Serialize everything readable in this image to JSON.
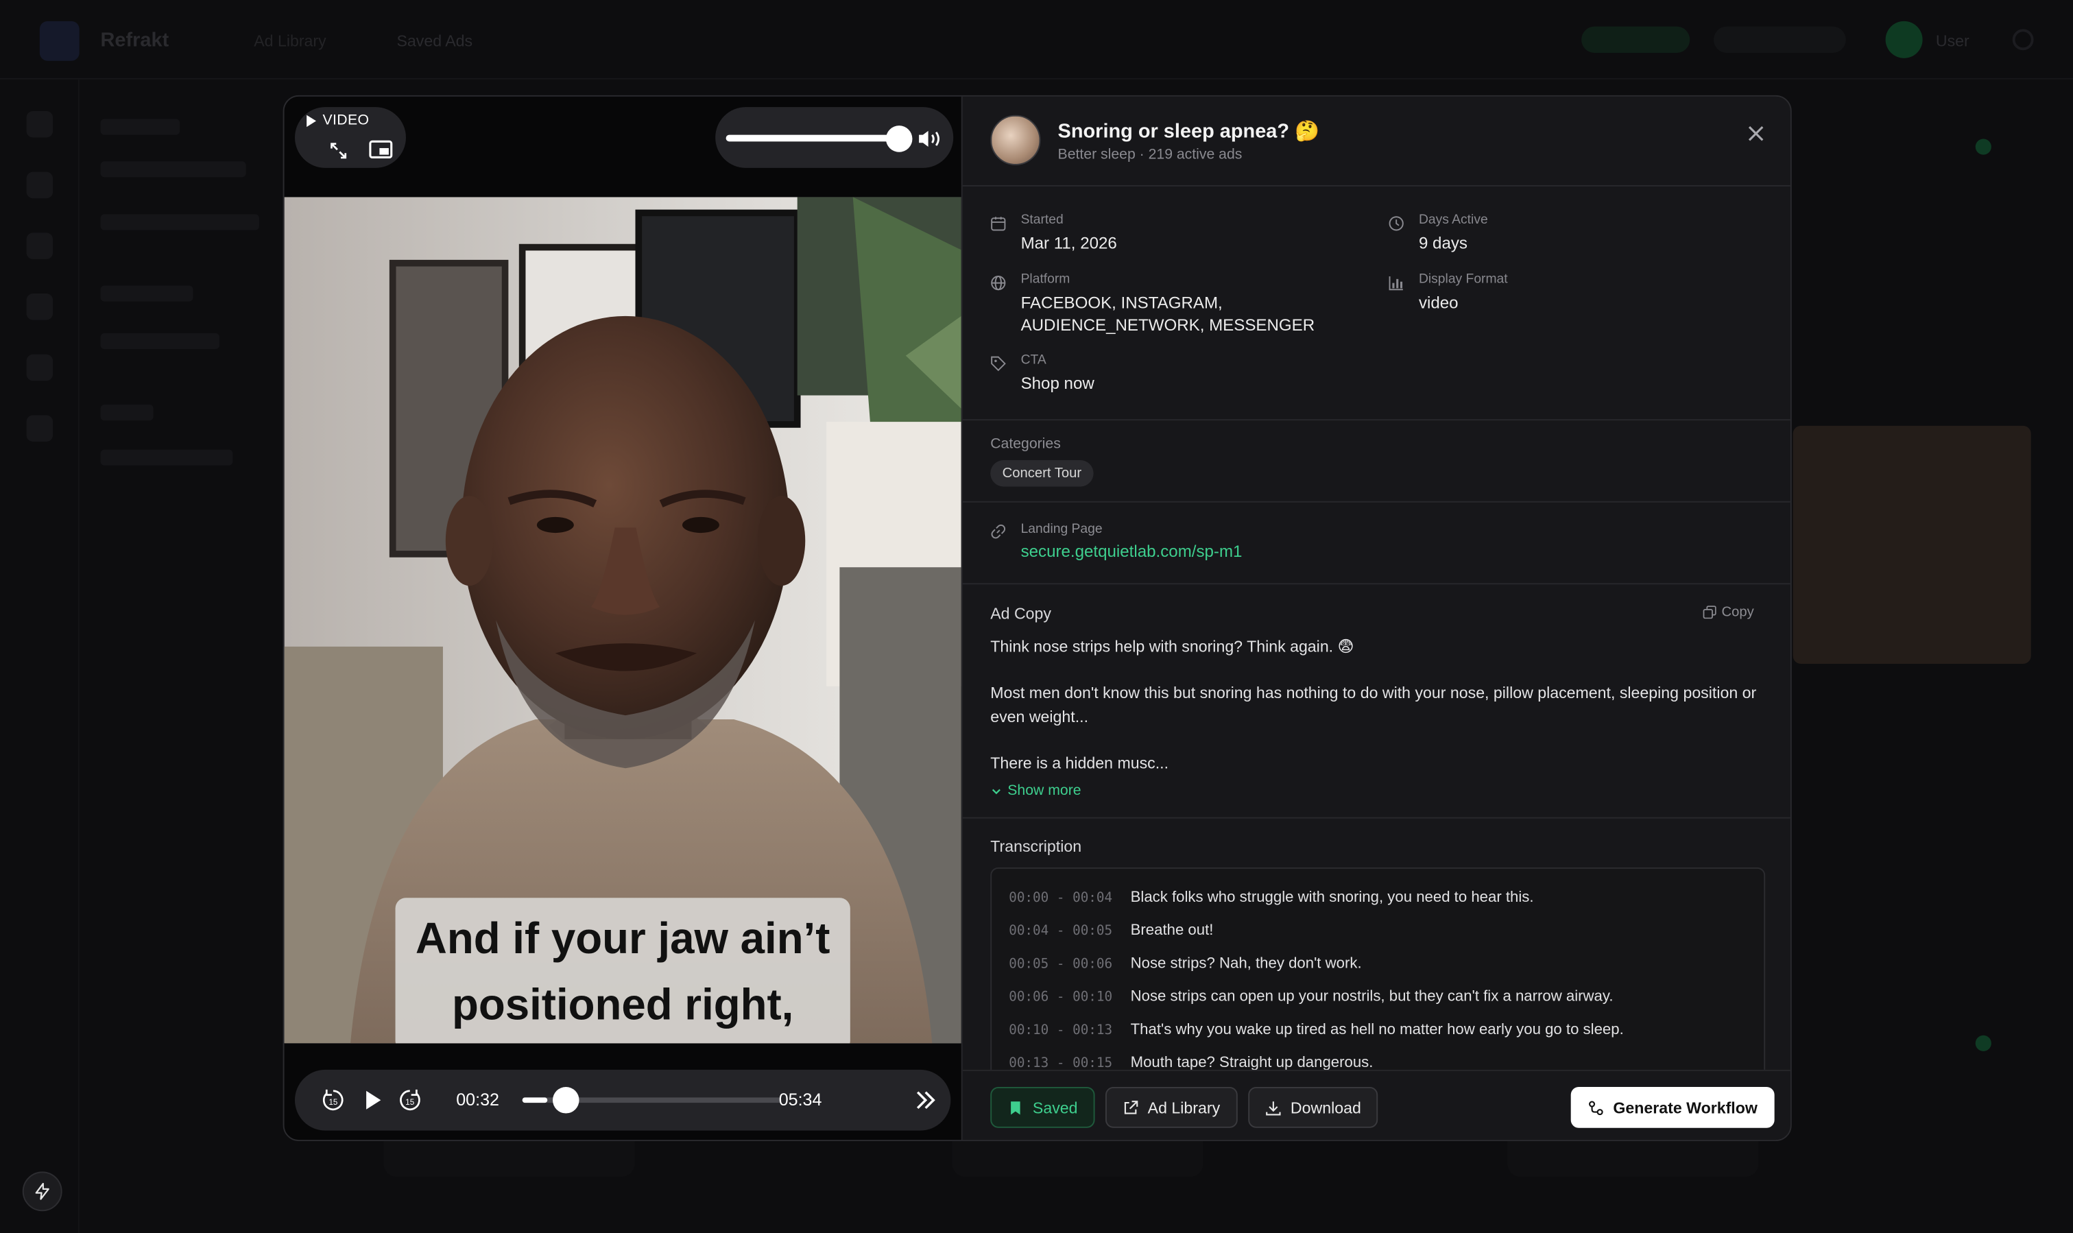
{
  "backdrop": {
    "brand": "Refrakt",
    "nav_1": "Ad Library",
    "nav_2": "Saved Ads",
    "user_label": "User"
  },
  "player": {
    "badge": "VIDEO",
    "caption_line1": "And if your jaw ain’t",
    "caption_line2": "positioned right,",
    "current_time": "00:32",
    "duration": "05:34",
    "progress_fraction": 0.096,
    "volume_fraction": 0.88,
    "skip_back_seconds": "15",
    "skip_forward_seconds": "15"
  },
  "ad": {
    "title": "Snoring or sleep apnea? 🤔",
    "subtitle": "Better sleep · 219 active ads"
  },
  "meta": {
    "started_label": "Started",
    "started_value": "Mar 11, 2026",
    "days_label": "Days Active",
    "days_value": "9 days",
    "platform_label": "Platform",
    "platform_value_line1": "FACEBOOK, INSTAGRAM,",
    "platform_value_line2": "AUDIENCE_NETWORK, MESSENGER",
    "format_label": "Display Format",
    "format_value": "video",
    "cta_label": "CTA",
    "cta_value": "Shop now"
  },
  "categories": {
    "label": "Categories",
    "items": [
      "Concert Tour"
    ]
  },
  "landing": {
    "label": "Landing Page",
    "url": "secure.getquietlab.com/sp-m1"
  },
  "ad_copy": {
    "title": "Ad Copy",
    "copy_label": "Copy",
    "para1": "Think nose strips help with snoring? Think again. 😨",
    "para2": "Most men don't know this but snoring has nothing to do with your nose, pillow placement, sleeping position or even weight...",
    "para3": "There is a hidden musc...",
    "show_more": "Show more"
  },
  "transcription": {
    "title": "Transcription",
    "rows": [
      {
        "time": "00:00 - 00:04",
        "text": "Black folks who struggle with snoring, you need to hear this."
      },
      {
        "time": "00:04 - 00:05",
        "text": "Breathe out!"
      },
      {
        "time": "00:05 - 00:06",
        "text": "Nose strips? Nah, they don't work."
      },
      {
        "time": "00:06 - 00:10",
        "text": "Nose strips can open up your nostrils, but they can't fix a narrow airway."
      },
      {
        "time": "00:10 - 00:13",
        "text": "That's why you wake up tired as hell no matter how early you go to sleep."
      },
      {
        "time": "00:13 - 00:15",
        "text": "Mouth tape? Straight up dangerous."
      }
    ]
  },
  "footer": {
    "saved": "Saved",
    "ad_library": "Ad Library",
    "download": "Download",
    "generate": "Generate Workflow"
  },
  "colors": {
    "accent": "#3ecf8e",
    "panel": "#17171a",
    "backdrop": "#0d0d0f"
  }
}
